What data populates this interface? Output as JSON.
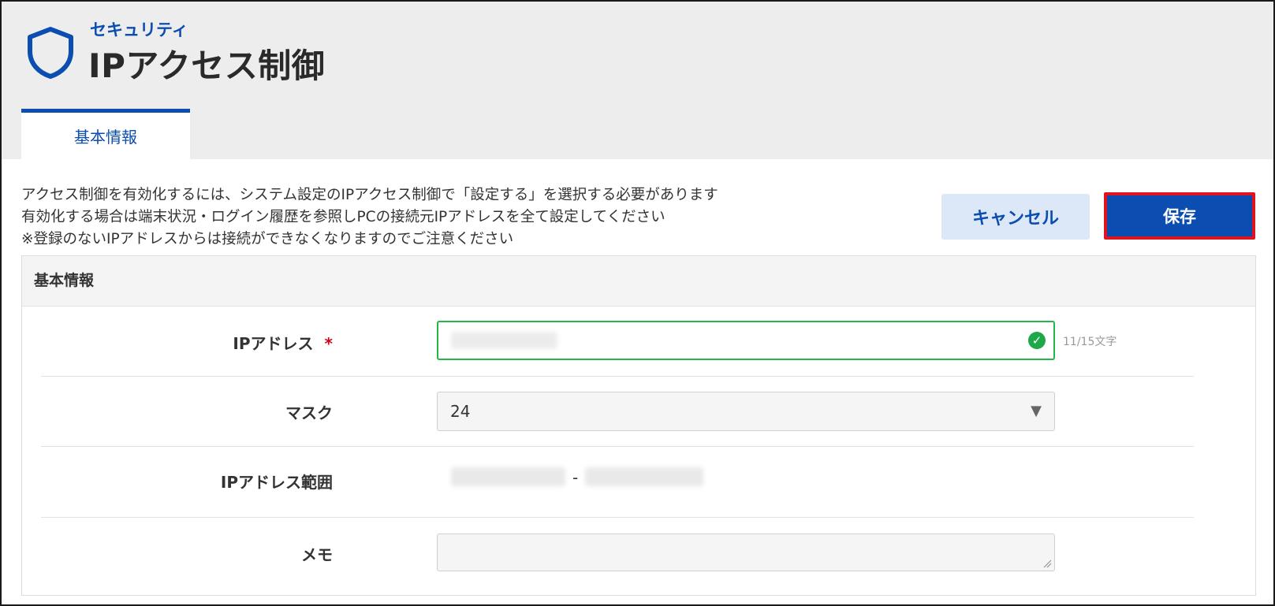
{
  "header": {
    "category": "セキュリティ",
    "title": "IPアクセス制御"
  },
  "tabs": [
    {
      "label": "基本情報",
      "active": true
    }
  ],
  "notice": {
    "lines": [
      "アクセス制御を有効化するには、システム設定のIPアクセス制御で「設定する」を選択する必要があります",
      "有効化する場合は端末状況・ログイン履歴を参照しPCの接続元IPアドレスを全て設定してください",
      "※登録のないIPアドレスからは接続ができなくなりますのでご注意ください"
    ]
  },
  "actions": {
    "cancel_label": "キャンセル",
    "save_label": "保存"
  },
  "form": {
    "section_title": "基本情報",
    "ip": {
      "label": "IPアドレス",
      "required_mark": "*",
      "counter": "11/15文字"
    },
    "mask": {
      "label": "マスク",
      "selected": "24"
    },
    "range": {
      "label": "IPアドレス範囲",
      "separator": "-"
    },
    "memo": {
      "label": "メモ"
    }
  },
  "icons": {
    "header": "shield-icon",
    "valid": "check-circle-icon",
    "dropdown": "caret-down-icon"
  },
  "colors": {
    "accent": "#0b4db0",
    "valid": "#28b446",
    "required": "#d0021b",
    "highlight": "#e0141e"
  }
}
